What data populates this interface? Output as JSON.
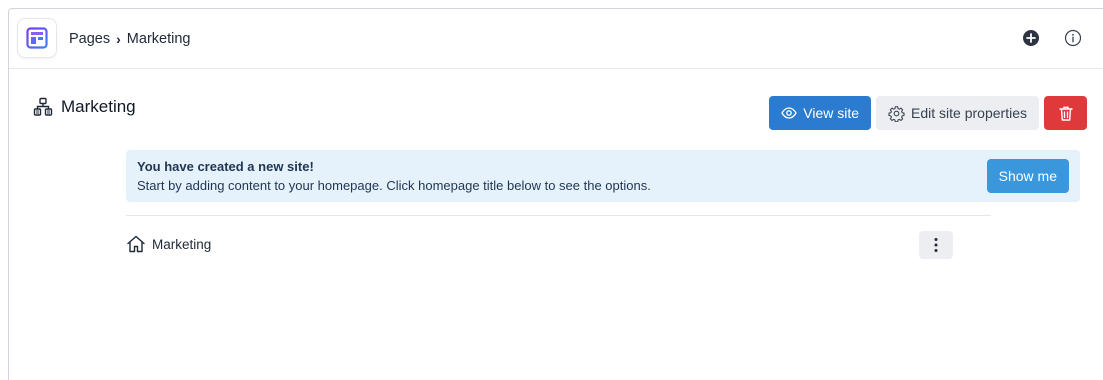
{
  "breadcrumb": {
    "root": "Pages",
    "separator": "›",
    "current": "Marketing"
  },
  "top_actions": {
    "add_icon": "plus-circle-icon",
    "info_icon": "info-circle-icon"
  },
  "page": {
    "title": "Marketing",
    "title_icon": "sitemap-icon"
  },
  "header_actions": {
    "view_site": "View site",
    "edit_properties": "Edit site properties",
    "delete_icon": "trash-icon"
  },
  "alert": {
    "title": "You have created a new site!",
    "text": "Start by adding content to your homepage. Click homepage title below to see the options.",
    "button": "Show me"
  },
  "tree": [
    {
      "label": "Marketing",
      "icon": "home-icon"
    }
  ],
  "colors": {
    "primary": "#2b7bd0",
    "danger": "#e0393b",
    "info_bg": "#e6f2fb",
    "info_button": "#3b97dc"
  }
}
